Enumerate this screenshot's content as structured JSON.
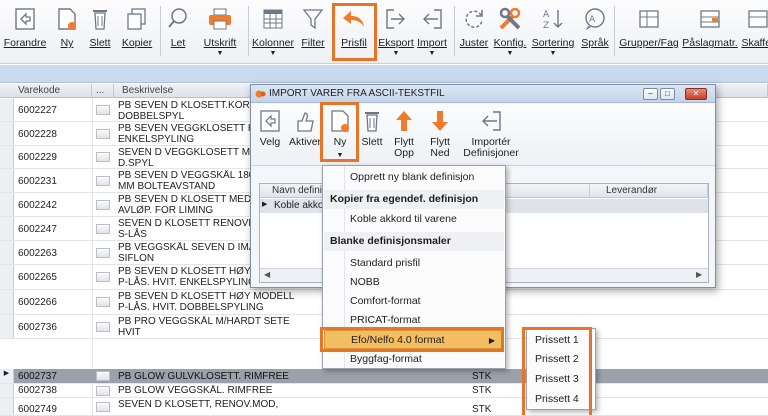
{
  "ribbon": {
    "buttons": [
      {
        "label": "Forandre",
        "icon": "edit-document-icon"
      },
      {
        "label": "Ny",
        "icon": "new-document-icon"
      },
      {
        "label": "Slett",
        "icon": "trash-icon"
      },
      {
        "label": "Kopier",
        "icon": "copy-icon"
      },
      {
        "label": "Let",
        "icon": "search-icon"
      },
      {
        "label": "Utskrift",
        "icon": "printer-icon"
      },
      {
        "label": "Kolonner",
        "icon": "columns-icon"
      },
      {
        "label": "Filter",
        "icon": "filter-icon"
      },
      {
        "label": "Prisfil",
        "icon": "undo-arrow-icon"
      },
      {
        "label": "Eksport",
        "icon": "export-icon"
      },
      {
        "label": "Import",
        "icon": "import-icon"
      },
      {
        "label": "Juster",
        "icon": "refresh-icon"
      },
      {
        "label": "Konfig.",
        "icon": "tools-icon"
      },
      {
        "label": "Sortering",
        "icon": "sort-az-icon"
      },
      {
        "label": "Språk",
        "icon": "language-icon"
      },
      {
        "label": "Grupper/Fag",
        "icon": "groups-icon"
      },
      {
        "label": "Påslagmatr.",
        "icon": "matrix-icon"
      },
      {
        "label": "Skaffer",
        "icon": "supplier-icon"
      }
    ]
  },
  "grid": {
    "columns": [
      "Varekode",
      "...",
      "Beskrivelse"
    ],
    "rows": [
      {
        "code": "6002227",
        "desc": "PB SEVEN D KLOSETT.KORT.P- DOBBELSPYL",
        "unit": ""
      },
      {
        "code": "6002228",
        "desc": "PB SEVEN VEGGKLOSETT HVIT ENKELSPYLING",
        "unit": ""
      },
      {
        "code": "6002229",
        "desc": "SEVEN D VEGGKLOSETT M/SIST D.SPYL",
        "unit": ""
      },
      {
        "code": "6002231",
        "desc": "PB SEVEN D VEGGSKÅL 180 OC MM BOLTEAVSTAND",
        "unit": ""
      },
      {
        "code": "6002242",
        "desc": "PB SEVEN D KLOSETT MED SKR AVLØP. FOR LIMING",
        "unit": ""
      },
      {
        "code": "6002247",
        "desc": "SEVEN D KLOSETT RENOVERIN S-LÅS",
        "unit": ""
      },
      {
        "code": "6002263",
        "desc": "PB VEGGSKÅL SEVEN D IMAGE SIFLON",
        "unit": ""
      },
      {
        "code": "6002265",
        "desc": "PB SEVEN D KLOSETT HØY MODELL P-LÅS. HVIT. ENKELSPYLING",
        "unit": ""
      },
      {
        "code": "6002266",
        "desc": "PB SEVEN D KLOSETT HØY MODELL P-LÅS. HVIT. DOBBELSPYLING",
        "unit": ""
      },
      {
        "code": "6002736",
        "desc": "PB PRO VEGGSKÅL M/HARDT SETE HVIT",
        "unit": ""
      },
      {
        "code": "6002737",
        "desc": "PB GLOW GULVKLOSETT. RIMFREE",
        "unit": "STK"
      },
      {
        "code": "6002738",
        "desc": "PB GLOW VEGGSKÅL. RIMFREE",
        "unit": "STK"
      },
      {
        "code": "6002749",
        "desc": "SEVEN D KLOSETT, RENOV.MOD,",
        "unit": "STK"
      }
    ]
  },
  "dialog": {
    "title": "IMPORT VARER FRA ASCII-TEKSTFIL",
    "toolbar": [
      {
        "label": "Velg",
        "icon": "select-icon"
      },
      {
        "label": "Aktiver",
        "icon": "activate-hand-icon"
      },
      {
        "label": "Ny",
        "icon": "new-document-icon"
      },
      {
        "label": "Slett",
        "icon": "trash-icon"
      },
      {
        "label": "Flytt Opp",
        "icon": "arrow-up-icon"
      },
      {
        "label": "Flytt Ned",
        "icon": "arrow-down-icon"
      },
      {
        "label": "Importér Definisjoner",
        "icon": "import-icon"
      }
    ],
    "columns": [
      "Navn definisjon",
      "Leverandør"
    ],
    "row": "Koble akkord"
  },
  "menu": {
    "create_blank": "Opprett ny blank definisjon",
    "copy_header": "Kopier fra egendef. definisjon",
    "copy_item": "Koble akkord til varene",
    "templates_header": "Blanke definisjonsmaler",
    "items": [
      "Standard prisfil",
      "NOBB",
      "Comfort-format",
      "PRICAT-format"
    ],
    "active_item": "Efo/Nelfo 4.0 format",
    "last_item": "Byggfag-format"
  },
  "submenu": {
    "items": [
      "Prissett 1",
      "Prissett 2",
      "Prissett 3",
      "Prissett 4"
    ]
  },
  "colors": {
    "highlight": "#e8742a",
    "accent_orange": "#f07b2a",
    "band_blue": "#c9daef"
  }
}
